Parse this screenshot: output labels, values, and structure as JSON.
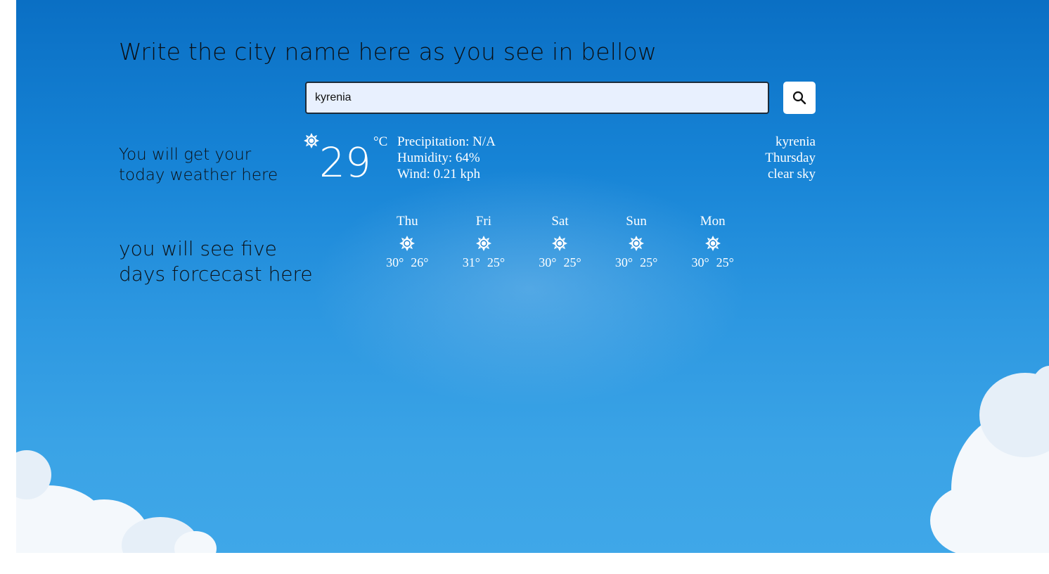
{
  "annotations": {
    "title": "Write the city name here as you see in bellow",
    "today_line1": "You will get your",
    "today_line2": "today weather here",
    "forecast_line1": "you will see five",
    "forecast_line2": "days forcecast here"
  },
  "search": {
    "value": "kyrenia",
    "icon": "search-icon"
  },
  "current": {
    "icon": "sun-icon",
    "temperature": "29",
    "unit": "°C",
    "precipitation": "Precipitation: N/A",
    "humidity": "Humidity: 64%",
    "wind": "Wind: 0.21 kph",
    "city": "kyrenia",
    "day": "Thursday",
    "description": "clear sky"
  },
  "forecast": [
    {
      "day": "Thu",
      "icon": "sun-icon",
      "high": "30°",
      "low": "26°"
    },
    {
      "day": "Fri",
      "icon": "sun-icon",
      "high": "31°",
      "low": "25°"
    },
    {
      "day": "Sat",
      "icon": "sun-icon",
      "high": "30°",
      "low": "25°"
    },
    {
      "day": "Sun",
      "icon": "sun-icon",
      "high": "30°",
      "low": "25°"
    },
    {
      "day": "Mon",
      "icon": "sun-icon",
      "high": "30°",
      "low": "25°"
    }
  ],
  "colors": {
    "sky_top": "#0a6fc4",
    "sky_bottom": "#3fa7e8",
    "text_light": "#ffffff",
    "annotation_text": "#0b0f14",
    "input_bg": "#e8f0fe"
  }
}
